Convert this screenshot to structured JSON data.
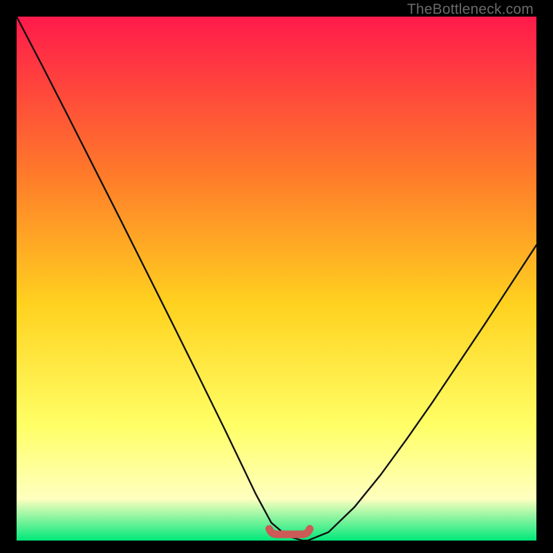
{
  "watermark": {
    "text": "TheBottleneck.com"
  },
  "colors": {
    "gradient_top": "#ff1a4b",
    "gradient_mid1": "#ff7a2a",
    "gradient_mid2": "#ffd21f",
    "gradient_mid3": "#ffff66",
    "gradient_mid4": "#ffffbf",
    "gradient_bottom": "#00e87a",
    "curve": "#101010",
    "flat_marker": "#cc5a57",
    "frame_bg": "#000000"
  },
  "chart_data": {
    "type": "line",
    "title": "",
    "xlabel": "",
    "ylabel": "",
    "xlim": [
      0,
      100
    ],
    "ylim": [
      0,
      100
    ],
    "series": [
      {
        "name": "bottleneck-curve",
        "x": [
          0,
          5,
          10,
          15,
          20,
          25,
          30,
          35,
          40,
          43,
          46,
          49,
          52,
          55,
          56,
          60,
          65,
          70,
          75,
          80,
          85,
          90,
          95,
          100
        ],
        "y": [
          100,
          90.5,
          80.8,
          71.0,
          61.2,
          51.3,
          41.4,
          31.4,
          21.3,
          15.1,
          8.9,
          3.4,
          0.9,
          0.0,
          0.0,
          1.6,
          6.4,
          12.5,
          19.3,
          26.4,
          33.8,
          41.2,
          48.8,
          56.4
        ]
      }
    ],
    "flat_region": {
      "x_start": 49,
      "x_end": 56,
      "y": 0.0
    }
  }
}
